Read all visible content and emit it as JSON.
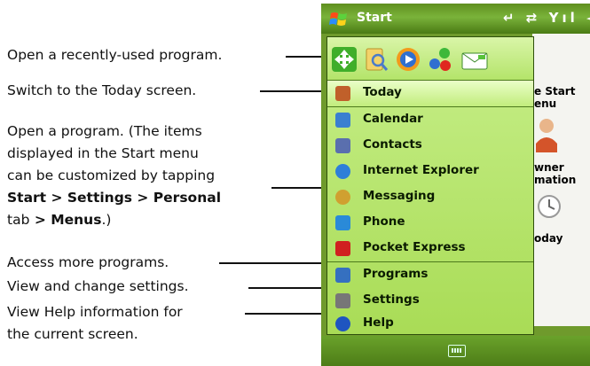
{
  "annotations": {
    "recent": "Open a recently-used program.",
    "today": "Switch to the Today screen.",
    "open_1": "Open a program. (The items",
    "open_2": "displayed in the Start menu",
    "open_3": "can be customized by tapping",
    "open_4_bold": "Start > Settings > Personal",
    "open_5_text": "tab",
    "open_5_bold": " > Menus",
    "open_5_end": ".)",
    "more": "Access more programs.",
    "settings": "View and change settings.",
    "help_1": "View Help information for",
    "help_2": "the current screen."
  },
  "device": {
    "title": "Start",
    "status_icons": "↵ ⇄ Yıl ◄€ ×",
    "background_items": [
      "e Start",
      "enu",
      "wner",
      "mation",
      "oday"
    ]
  },
  "start_menu": {
    "recent_programs": [
      "move-icon",
      "file-explorer-icon",
      "media-player-icon",
      "games-icon",
      "messaging-icon"
    ],
    "items": [
      {
        "label": "Today",
        "icon": "today-icon",
        "color": "#c0602a"
      },
      {
        "label": "Calendar",
        "icon": "calendar-icon",
        "color": "#3a7fd0"
      },
      {
        "label": "Contacts",
        "icon": "contacts-icon",
        "color": "#5a6fae"
      },
      {
        "label": "Internet Explorer",
        "icon": "internet-explorer-icon",
        "color": "#2e7fd9"
      },
      {
        "label": "Messaging",
        "icon": "messaging-icon",
        "color": "#d0a030"
      },
      {
        "label": "Phone",
        "icon": "phone-icon",
        "color": "#2a8ad8"
      },
      {
        "label": "Pocket Express",
        "icon": "pocket-express-icon",
        "color": "#d02020"
      }
    ],
    "bottom_items": [
      {
        "label": "Programs",
        "icon": "programs-icon",
        "color": "#3570c0"
      },
      {
        "label": "Settings",
        "icon": "settings-icon",
        "color": "#777777"
      },
      {
        "label": "Help",
        "icon": "help-icon",
        "color": "#1f55c0"
      }
    ]
  }
}
